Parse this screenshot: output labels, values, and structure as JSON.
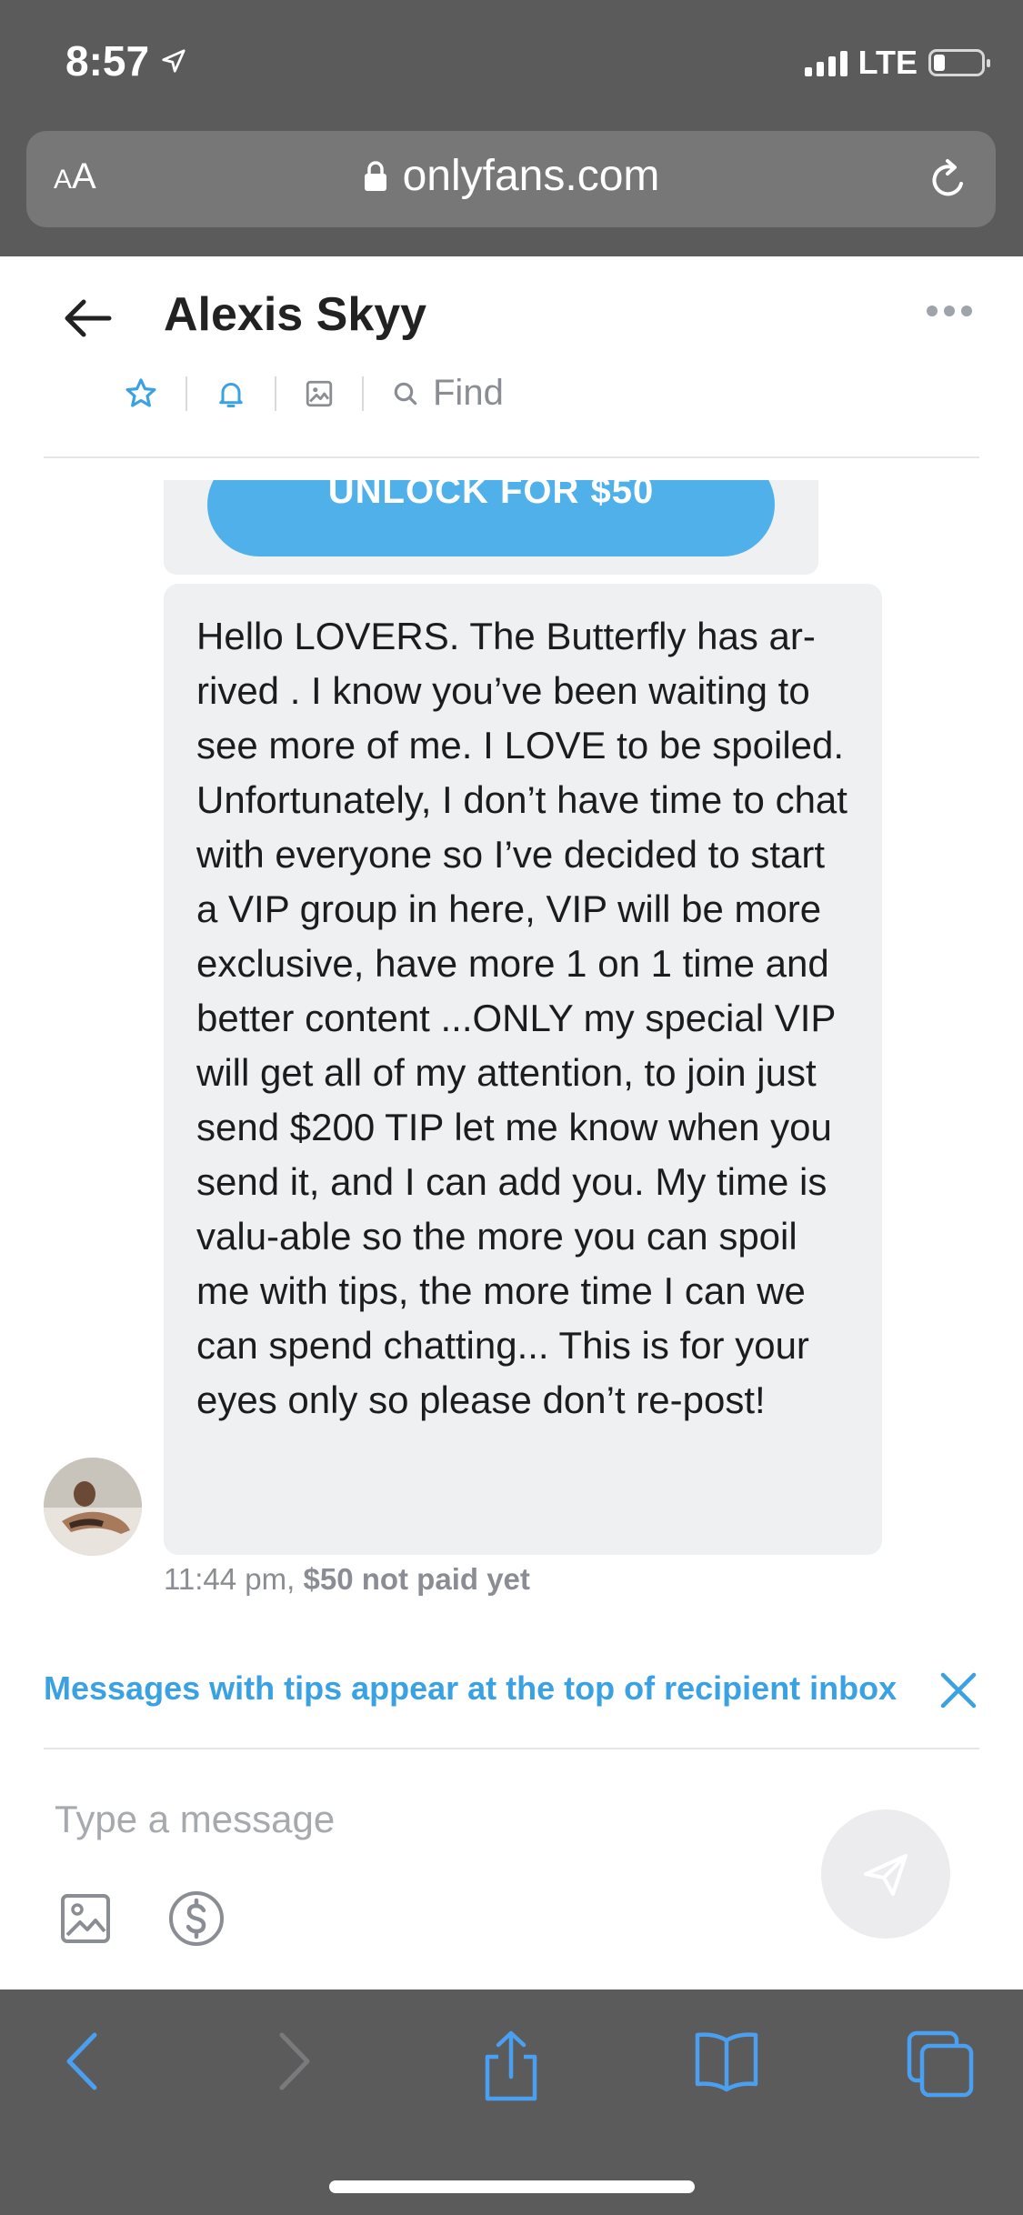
{
  "status": {
    "time": "8:57",
    "network": "LTE",
    "battery_level": 0.2
  },
  "browser": {
    "text_size_button": "AA",
    "url": "onlyfans.com"
  },
  "chat": {
    "contact_name": "Alexis Skyy",
    "find_label": "Find"
  },
  "previous_message": {
    "unlock_label": "UNLOCK FOR $50"
  },
  "message": {
    "text": "Hello LOVERS. The Butterfly has ar-rived . I know you’ve been waiting to see more of me. I LOVE to be spoiled. Unfortunately, I don’t have time to chat with everyone so I’ve decided to start a VIP group in here, VIP will be more exclusive, have more 1 on 1 time and better content ...ONLY my special VIP will get all of my attention, to join just send $200 TIP let me know when you send it, and I can add you. My time is valu-able so the more you can spoil me with tips, the more time I can we can spend chatting... This is for your eyes only so please don’t re-post!",
    "time": "11:44 pm,",
    "payment_status": "$50 not paid yet"
  },
  "tip_notice": "Messages with tips appear at the top of recipient inbox",
  "composer": {
    "placeholder": "Type a message"
  },
  "colors": {
    "accent": "#3aa1e3",
    "unlock_button": "#50b1ea",
    "bubble": "#eff0f2",
    "chrome": "#5b5b5c",
    "safari_blue": "#4a9ff0"
  },
  "icons": [
    "location-arrow-icon",
    "lock-icon",
    "reload-icon",
    "back-arrow-icon",
    "more-icon",
    "star-icon",
    "bell-icon",
    "image-icon",
    "search-icon",
    "close-icon",
    "image-attach-icon",
    "dollar-icon",
    "send-icon",
    "safari-back-icon",
    "safari-forward-icon",
    "share-icon",
    "bookmarks-icon",
    "tabs-icon"
  ]
}
